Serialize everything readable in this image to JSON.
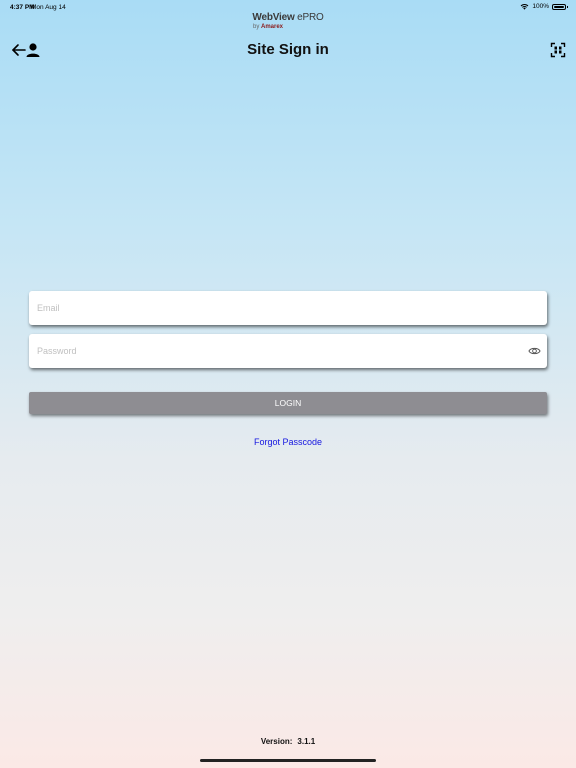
{
  "status_bar": {
    "time": "4:37 PM",
    "date": "Mon Aug 14",
    "battery": "100%",
    "icons": [
      "wifi-icon",
      "battery-icon"
    ]
  },
  "logo": {
    "main_bold": "WebView",
    "main_light": " ePRO",
    "by": "by ",
    "company": "Amarex"
  },
  "header": {
    "title": "Site Sign in",
    "back_icon": "back-user-icon",
    "scan_icon": "scan-icon"
  },
  "form": {
    "email_placeholder": "Email",
    "email_value": "",
    "password_placeholder": "Password",
    "password_value": "",
    "password_toggle_icon": "eye-icon",
    "login_label": "LOGIN",
    "forgot_label": "Forgot Passcode"
  },
  "footer": {
    "version_label": "Version:",
    "version_value": "3.1.1"
  },
  "colors": {
    "login_button": "#8e8d92",
    "link": "#1515e0",
    "logo_company": "#8b1a1a"
  }
}
